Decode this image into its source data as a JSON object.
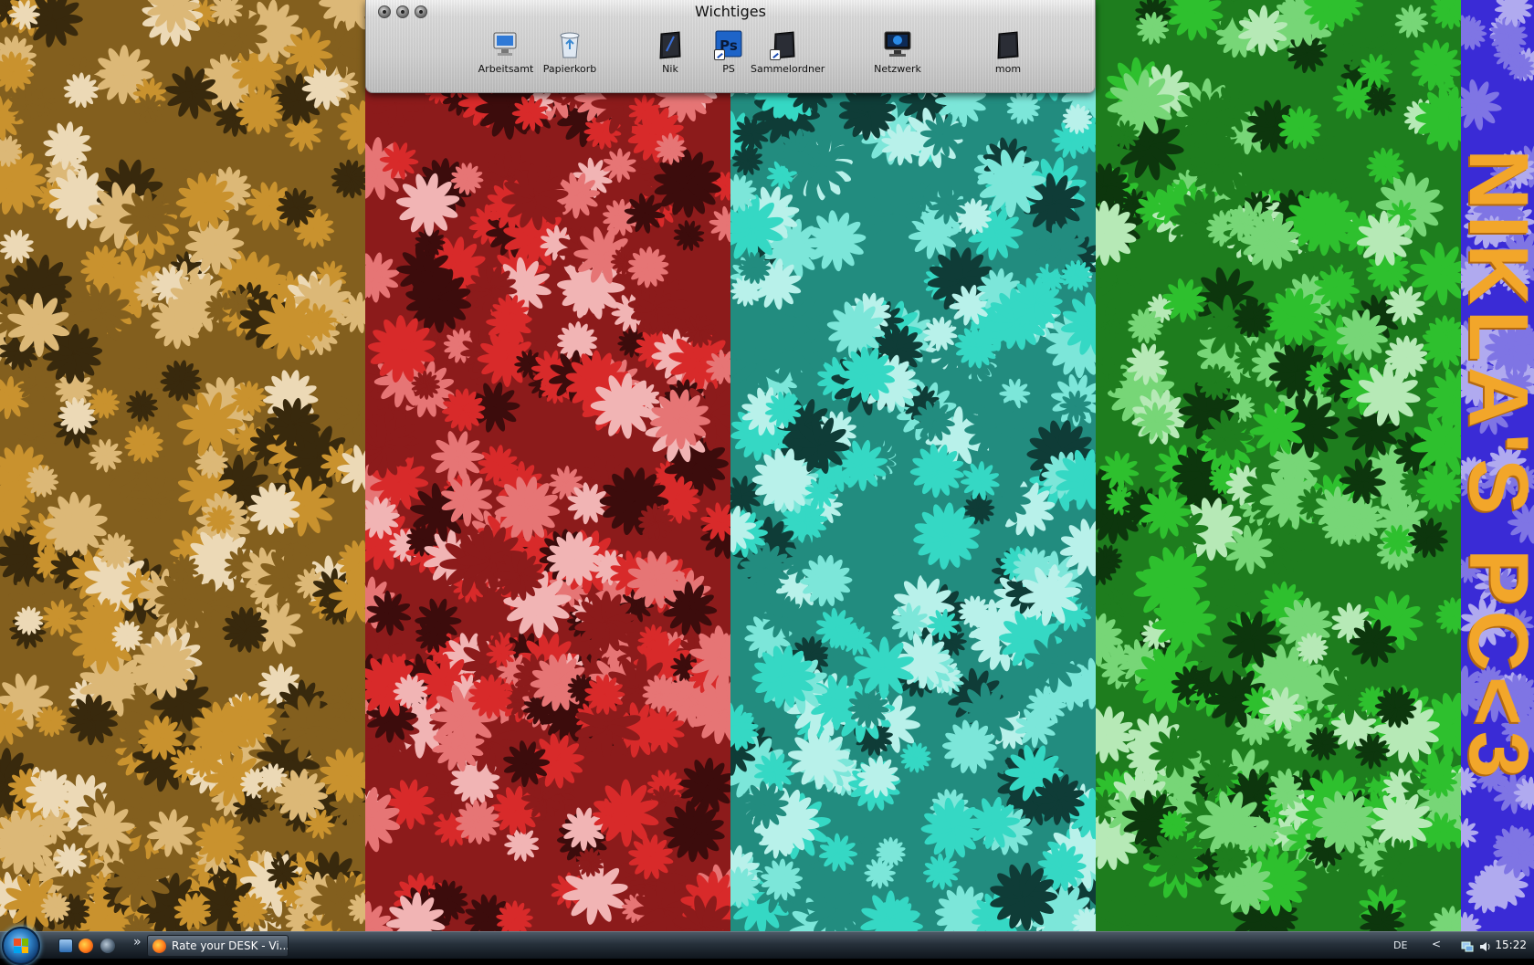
{
  "stack_window": {
    "title": "Wichtiges",
    "icons": [
      {
        "label": "Arbeitsamt",
        "icon": "computer-icon"
      },
      {
        "label": "Papierkorb",
        "icon": "recycle-bin-icon"
      },
      {
        "label": "Nik",
        "icon": "user-folder-icon"
      },
      {
        "label": "PS",
        "icon": "photoshop-icon"
      },
      {
        "label": "Sammelordner",
        "icon": "folder-shortcut-icon"
      },
      {
        "label": "Netzwerk",
        "icon": "network-icon"
      },
      {
        "label": "mom",
        "icon": "user-folder-icon"
      }
    ]
  },
  "wallpaper": {
    "banner_text": "NIKLA'S PC<3",
    "stripe_colors": [
      "#c9922e",
      "#d82a2a",
      "#35d8c4",
      "#2ec02e"
    ],
    "banner_color": "#3a2bd6",
    "banner_text_color": "#f2a62a"
  },
  "taskbar": {
    "quick_launch": [
      "show-desktop-icon",
      "firefox-icon",
      "media-icon"
    ],
    "overflow": "»",
    "active_task": {
      "label": "Rate your DESK - Vi...",
      "icon": "firefox-icon"
    },
    "tray": {
      "language": "DE",
      "expand": "<",
      "clock": "15:22"
    }
  }
}
